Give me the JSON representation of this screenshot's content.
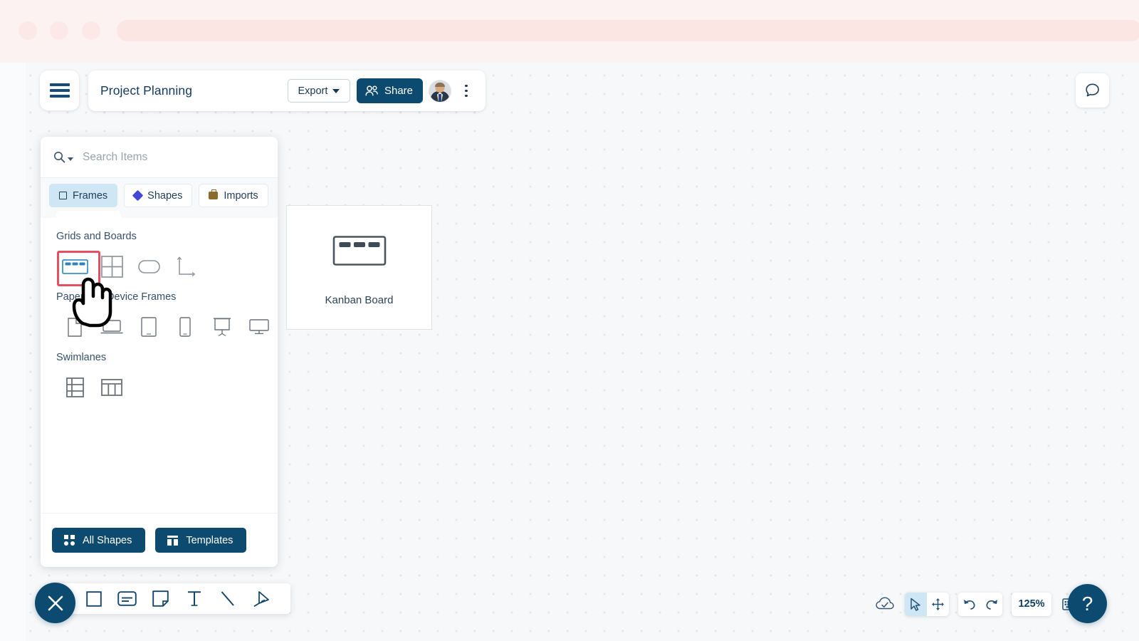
{
  "browser": {
    "dots": [
      "dot-1",
      "dot-2",
      "dot-3"
    ]
  },
  "topbar": {
    "menu_icon": "hamburger-icon",
    "doc_title": "Project Planning",
    "export_label": "Export",
    "export_caret": "chevron-down-icon",
    "share_label": "Share",
    "share_icon": "people-icon",
    "avatar": "user-avatar",
    "more_icon": "kebab-menu-icon",
    "comment_icon": "comment-bubble-icon"
  },
  "panel": {
    "search": {
      "icon": "search-icon",
      "caret": "caret-down-icon",
      "placeholder": "Search Items",
      "value": ""
    },
    "tabs": [
      {
        "label": "Frames",
        "icon": "square-outline-icon",
        "active": true
      },
      {
        "label": "Shapes",
        "icon": "diamond-icon",
        "active": false
      },
      {
        "label": "Imports",
        "icon": "briefcase-icon",
        "active": false
      }
    ],
    "sections": [
      {
        "title": "Grids and Boards",
        "items": [
          {
            "name": "kanban-board-frame",
            "selected": true
          },
          {
            "name": "grid-frame",
            "selected": false
          },
          {
            "name": "rounded-rect-frame",
            "selected": false
          },
          {
            "name": "axis-frame",
            "selected": false
          }
        ]
      },
      {
        "title": "Paper and Device Frames",
        "items": [
          {
            "name": "document-frame",
            "selected": false
          },
          {
            "name": "laptop-frame",
            "selected": false
          },
          {
            "name": "tablet-frame",
            "selected": false
          },
          {
            "name": "phone-frame",
            "selected": false
          },
          {
            "name": "presentation-frame",
            "selected": false
          },
          {
            "name": "monitor-frame",
            "selected": false
          }
        ]
      },
      {
        "title": "Swimlanes",
        "items": [
          {
            "name": "horizontal-swimlane-frame",
            "selected": false
          },
          {
            "name": "vertical-swimlane-frame",
            "selected": false
          }
        ]
      }
    ],
    "footer": {
      "all_shapes_label": "All Shapes",
      "all_shapes_icon": "grid-dots-icon",
      "templates_label": "Templates",
      "templates_icon": "template-layout-icon"
    }
  },
  "canvas": {
    "preview_card": {
      "label": "Kanban Board",
      "icon": "kanban-board-icon"
    },
    "cursor": "pointing-hand-cursor"
  },
  "bottom_toolbar": {
    "close_icon": "close-x-icon",
    "tools": [
      {
        "name": "rectangle-tool",
        "icon": "square-icon"
      },
      {
        "name": "card-tool",
        "icon": "card-icon"
      },
      {
        "name": "sticky-note-tool",
        "icon": "sticky-note-icon"
      },
      {
        "name": "text-tool",
        "icon": "text-t-icon"
      },
      {
        "name": "line-tool",
        "icon": "diagonal-line-icon"
      },
      {
        "name": "pen-tool",
        "icon": "pen-nib-icon"
      }
    ]
  },
  "bottom_right": {
    "save_status_icon": "cloud-check-icon",
    "select_icon": "cursor-arrow-icon",
    "pan_icon": "move-arrows-icon",
    "undo_icon": "undo-arrow-icon",
    "redo_icon": "redo-arrow-icon",
    "zoom_level": "125%",
    "keyboard_icon": "keyboard-icon",
    "help_label": "?"
  },
  "colors": {
    "brand_navy": "#0d4a70",
    "tab_active_blue": "#cfe6f5",
    "selection_red": "#e4505f",
    "shapes_diamond": "#4349d6",
    "canvas_bg": "#f7f8f9"
  }
}
